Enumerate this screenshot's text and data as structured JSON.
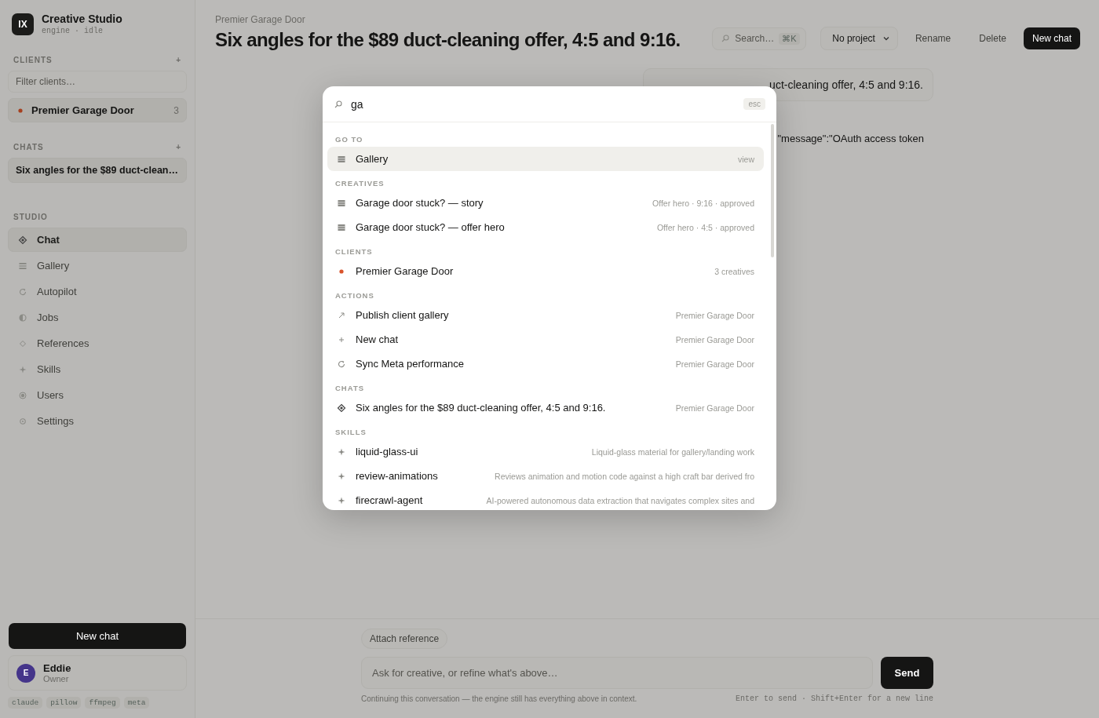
{
  "sidebar": {
    "brand": {
      "logo": "IX",
      "name": "Creative Studio",
      "status": "engine · idle"
    },
    "clients": {
      "heading": "CLIENTS",
      "add": "+",
      "filter_placeholder": "Filter clients…",
      "items": [
        {
          "name": "Premier Garage Door",
          "count": "3",
          "color": "#a6401f",
          "selected": true
        }
      ]
    },
    "chats": {
      "heading": "CHATS",
      "add": "+",
      "items": [
        {
          "title": "Six angles for the $89 duct-clean…",
          "selected": true
        }
      ]
    },
    "studio": {
      "heading": "STUDIO",
      "items": [
        {
          "label": "Chat",
          "kind": "diamond",
          "selected": true
        },
        {
          "label": "Gallery",
          "kind": "grid",
          "selected": false
        },
        {
          "label": "Autopilot",
          "kind": "refresh",
          "selected": false
        },
        {
          "label": "Jobs",
          "kind": "half",
          "selected": false
        },
        {
          "label": "References",
          "kind": "outline",
          "selected": false
        },
        {
          "label": "Skills",
          "kind": "sparkle",
          "selected": false
        },
        {
          "label": "Users",
          "kind": "target",
          "selected": false
        },
        {
          "label": "Settings",
          "kind": "gear",
          "selected": false
        }
      ]
    },
    "new_chat": "New chat",
    "user": {
      "initial": "E",
      "name": "Eddie",
      "role": "Owner"
    },
    "tags": [
      "claude",
      "pillow",
      "ffmpeg",
      "meta"
    ]
  },
  "header": {
    "breadcrumb": "Premier Garage Door",
    "title": "Six angles for the $89 duct-cleaning offer, 4:5 and 9:16.",
    "search": {
      "placeholder": "Search…",
      "shortcut": "⌘K"
    },
    "project": "No project",
    "buttons": [
      {
        "label": "Rename",
        "kind": "plain"
      },
      {
        "label": "Delete",
        "kind": "plain"
      },
      {
        "label": "New chat",
        "kind": "primary"
      }
    ]
  },
  "messages": [
    {
      "kind": "bubble",
      "text": "uct-cleaning offer, 4:5 and 9:16."
    },
    {
      "kind": "plain",
      "text": "\"message\":\"OAuth access token"
    }
  ],
  "composer": {
    "attach": "Attach reference",
    "placeholder": "Ask for creative, or refine what's above…",
    "send": "Send",
    "note": "Continuing this conversation — the engine still has everything above in context.",
    "keys": "Enter to send · Shift+Enter for a new line"
  },
  "palette": {
    "query": "ga",
    "esc": "esc",
    "sections": [
      {
        "heading": "GO TO",
        "items": [
          {
            "kind": "grid",
            "label": "Gallery",
            "meta": "view",
            "selected": true
          }
        ]
      },
      {
        "heading": "CREATIVES",
        "items": [
          {
            "kind": "grid",
            "label": "Garage door stuck? — story",
            "meta": "Offer hero · 9:16 · approved",
            "selected": false
          },
          {
            "kind": "grid",
            "label": "Garage door stuck? — offer hero",
            "meta": "Offer hero · 4:5 · approved",
            "selected": false
          }
        ]
      },
      {
        "heading": "CLIENTS",
        "items": [
          {
            "kind": "dot",
            "color": "#d9532b",
            "label": "Premier Garage Door",
            "meta": "3 creatives",
            "selected": false
          }
        ]
      },
      {
        "heading": "ACTIONS",
        "items": [
          {
            "kind": "arrow",
            "label": "Publish client gallery",
            "meta": "Premier Garage Door",
            "selected": false
          },
          {
            "kind": "plus",
            "label": "New chat",
            "meta": "Premier Garage Door",
            "selected": false
          },
          {
            "kind": "refresh",
            "label": "Sync Meta performance",
            "meta": "Premier Garage Door",
            "selected": false
          }
        ]
      },
      {
        "heading": "CHATS",
        "items": [
          {
            "kind": "diamond",
            "label": "Six angles for the $89 duct-cleaning offer, 4:5 and 9:16.",
            "meta": "Premier Garage Door",
            "selected": false
          }
        ]
      },
      {
        "heading": "SKILLS",
        "items": [
          {
            "kind": "sparkle",
            "label": "liquid-glass-ui",
            "meta": "Liquid-glass material for gallery/landing work",
            "selected": false
          },
          {
            "kind": "sparkle",
            "label": "review-animations",
            "meta": "Reviews animation and motion code against a high craft bar derived fro",
            "selected": false
          },
          {
            "kind": "sparkle",
            "label": "firecrawl-agent",
            "meta": "AI-powered autonomous data extraction that navigates complex sites and",
            "selected": false
          }
        ]
      }
    ]
  }
}
